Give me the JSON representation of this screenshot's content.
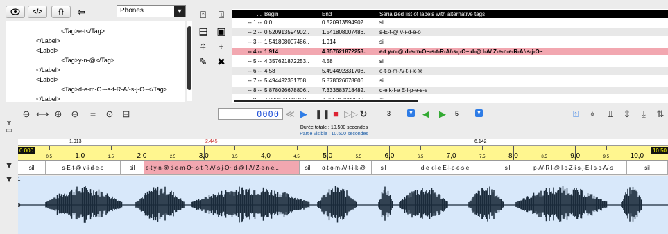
{
  "top_toolbar": {
    "view_icon": "eye-icon",
    "code_icon": "code-icon",
    "braces_label": "{}",
    "back_icon": "back-arrow-icon",
    "tier_select": "Phones"
  },
  "tree": {
    "lines": [
      "<Tag>e-t</Tag>",
      "</Label>",
      "<Label>",
      "<Tag>y-n-@</Tag>",
      "</Label>",
      "<Label>",
      "<Tag>d-e-m-O~-s-t-R-A/-s-j-O~</Tag>",
      "</Label>"
    ]
  },
  "table": {
    "headers": [
      "...",
      "Begin",
      "End",
      "Serialized list of labels with alternative tags"
    ],
    "rows": [
      {
        "idx": "-- 1 --",
        "begin": "0.0",
        "end": "0.520913594902..",
        "labels": "sil"
      },
      {
        "idx": "-- 2 --",
        "begin": "0.520913594902..",
        "end": "1.541808007486..",
        "labels": "s-E-t-@ v-i-d-e-o"
      },
      {
        "idx": "-- 3 --",
        "begin": "1.541808007486..",
        "end": "1.914",
        "labels": "sil"
      },
      {
        "idx": "-- 4 --",
        "begin": "1.914",
        "end": "4.357621872253..",
        "labels": "e-t y-n-@ d-e-m-O~-s-t-R-A/-s-j-O~ d-@ l-A/ Z-e-n-e-R-A/-s-j-O~"
      },
      {
        "idx": "-- 5 --",
        "begin": "4.357621872253..",
        "end": "4.58",
        "labels": "sil"
      },
      {
        "idx": "-- 6 --",
        "begin": "4.58",
        "end": "5.494492331708..",
        "labels": "o-t-o-m-A/-t-i-k-@"
      },
      {
        "idx": "-- 7 --",
        "begin": "5.494492331708..",
        "end": "5.878026678806..",
        "labels": "sil"
      },
      {
        "idx": "-- 8 --",
        "begin": "5.878026678806..",
        "end": "7.333683718482..",
        "labels": "d-e k-l-e E-l-p-e-s-e"
      },
      {
        "idx": "-- 9 --",
        "begin": "7.333683718482..",
        "end": "7.805217000048..",
        "labels": "sil"
      }
    ],
    "selected_row": 3
  },
  "player": {
    "time_display": "0000",
    "stepper_a": "3",
    "stepper_b": "5"
  },
  "timeline": {
    "total": "Durée totale : 10.500 secondes",
    "visible": "Partie visible : 10.500 secondes",
    "cursor_left": "1.913",
    "cursor_mid": "2.445",
    "cursor_right": "6.142",
    "start": "0.000",
    "end": "10.50",
    "major_ticks": [
      "1,0",
      "2,0",
      "3,0",
      "4,0",
      "5,0",
      "6,0",
      "7,0",
      "8,0",
      "9,0",
      "10,0"
    ],
    "minor_ticks": [
      "0.5",
      "1.5",
      "2.5",
      "3.5",
      "4.5",
      "5.5",
      "6.5",
      "7.5",
      "8.5",
      "9.5"
    ]
  },
  "tier_segments": [
    {
      "label": "sil"
    },
    {
      "label": "s-E-t-@ v-i-d-e-o"
    },
    {
      "label": "sil"
    },
    {
      "label": "e-t y-n-@ d-e-m-O~-s-t-R-A/-s-j-O~ d-@ l-A/ Z-e-n-e..."
    },
    {
      "label": "sil"
    },
    {
      "label": "o-t-o-m-A/-t-i-k-@"
    },
    {
      "label": "sil"
    },
    {
      "label": "d-e k-l-e E-l-p-e-s-e"
    },
    {
      "label": "sil"
    },
    {
      "label": "p-A/-R l-@ l-o-Z-i-s-j-E-l s-p-A/-s"
    },
    {
      "label": "sil"
    }
  ],
  "waveform": {
    "top_value": "1",
    "mid_value": "0",
    "color": "#1a2a3a",
    "background": "#d8e8fa"
  },
  "colors": {
    "selection": "#f2a7b0",
    "ruler": "#fff68f",
    "accent": "#2e7ce6"
  }
}
